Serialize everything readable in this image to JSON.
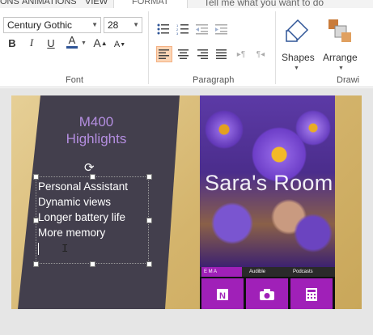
{
  "tabs": [
    "ONS",
    "ANIMATIONS",
    "VIEW",
    "FORMAT"
  ],
  "tell_me": "Tell me what you want to do",
  "font": {
    "family": "Century Gothic",
    "size": "28",
    "group_label": "Font",
    "bold": "B",
    "italic": "I",
    "underline": "U",
    "font_color": "A",
    "grow": "A",
    "shrink": "A"
  },
  "paragraph": {
    "group_label": "Paragraph"
  },
  "drawing": {
    "shapes_label": "Shapes",
    "arrange_label": "Arrange",
    "group_label": "Drawi"
  },
  "slide": {
    "title_line1": "M400",
    "title_line2": "Highlights",
    "bullets": [
      "Personal Assistant",
      "Dynamic views",
      "Longer battery life",
      "More memory"
    ],
    "phone_title": "Sara's Room",
    "tile_labels": [
      "E M A",
      "Audible",
      "Podcasts"
    ]
  },
  "colors": {
    "accent_selected": "#fcd5b5",
    "panel": "#433f4d",
    "title": "#b48ee0",
    "tile": "#a020b8",
    "font_color_bar": "#2f5597"
  }
}
